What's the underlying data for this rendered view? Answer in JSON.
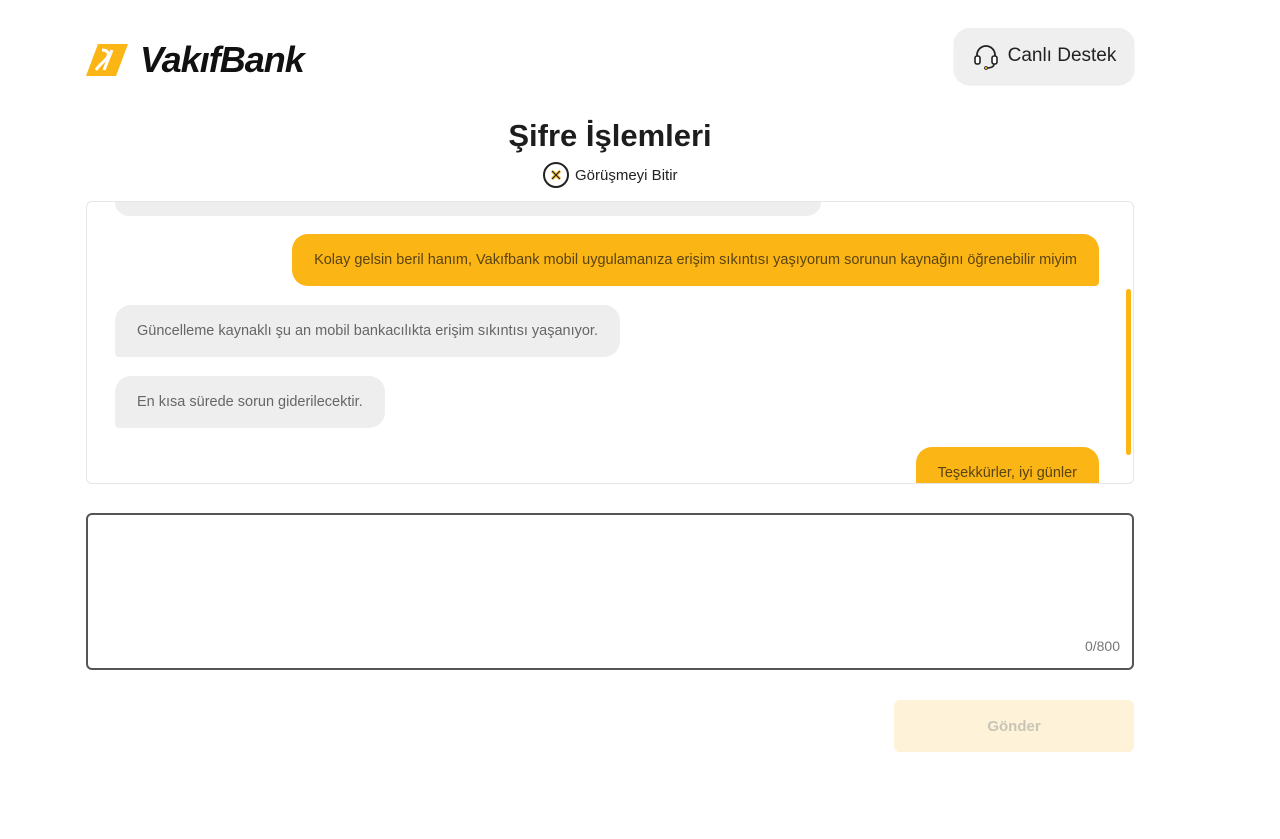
{
  "brand": {
    "name": "VakıfBank",
    "accent": "#fbb515"
  },
  "header": {
    "support_label": "Canlı Destek",
    "support_icon": "headset-icon"
  },
  "page": {
    "title": "Şifre İşlemleri",
    "end_chat_label": "Görüşmeyi Bitir",
    "end_chat_icon": "close-circle-icon"
  },
  "chat": {
    "messages": [
      {
        "from": "user",
        "text": "Kolay gelsin beril hanım, Vakıfbank mobil uygulamanıza erişim sıkıntısı yaşıyorum sorunun kaynağını öğrenebilir miyim"
      },
      {
        "from": "agent",
        "text": "Güncelleme kaynaklı şu an mobil bankacılıkta erişim sıkıntısı yaşanıyor."
      },
      {
        "from": "agent",
        "text": "En kısa sürede sorun giderilecektir."
      },
      {
        "from": "user",
        "text": "Teşekkürler, iyi günler"
      }
    ]
  },
  "composer": {
    "value": "",
    "counter": "0/800"
  },
  "send_label": "Gönder"
}
